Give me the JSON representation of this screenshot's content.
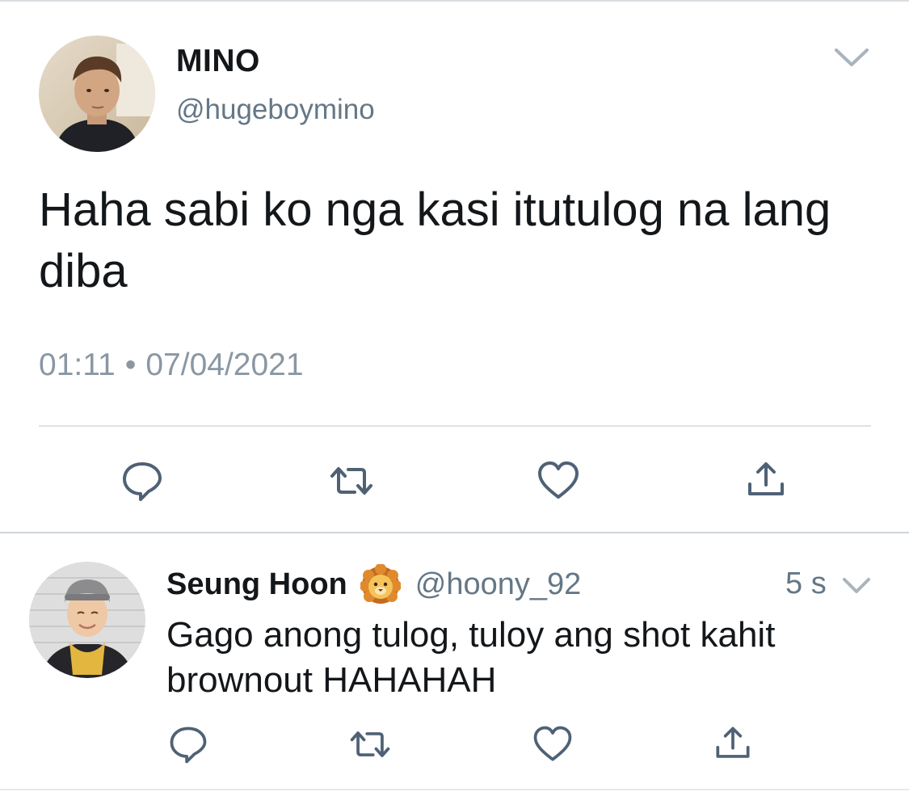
{
  "tweet": {
    "author_name": "MINO",
    "author_handle": "@hugeboymino",
    "text": "Haha sabi ko nga kasi itutulog na lang diba",
    "time": "01:11",
    "separator": "•",
    "date": "07/04/2021"
  },
  "actions": [
    "reply-icon",
    "retweet-icon",
    "like-icon",
    "share-icon"
  ],
  "reply": {
    "author_name": "Seung Hoon",
    "emoji": "lion-face-emoji",
    "author_handle": "@hoony_92",
    "time": "5 s",
    "text": "Gago anong tulog, tuloy ang shot kahit brownout HAHAHAH"
  },
  "colors": {
    "text": "#14171a",
    "secondary": "#657786",
    "icon": "#4f6175",
    "divider": "#dde2e6"
  }
}
